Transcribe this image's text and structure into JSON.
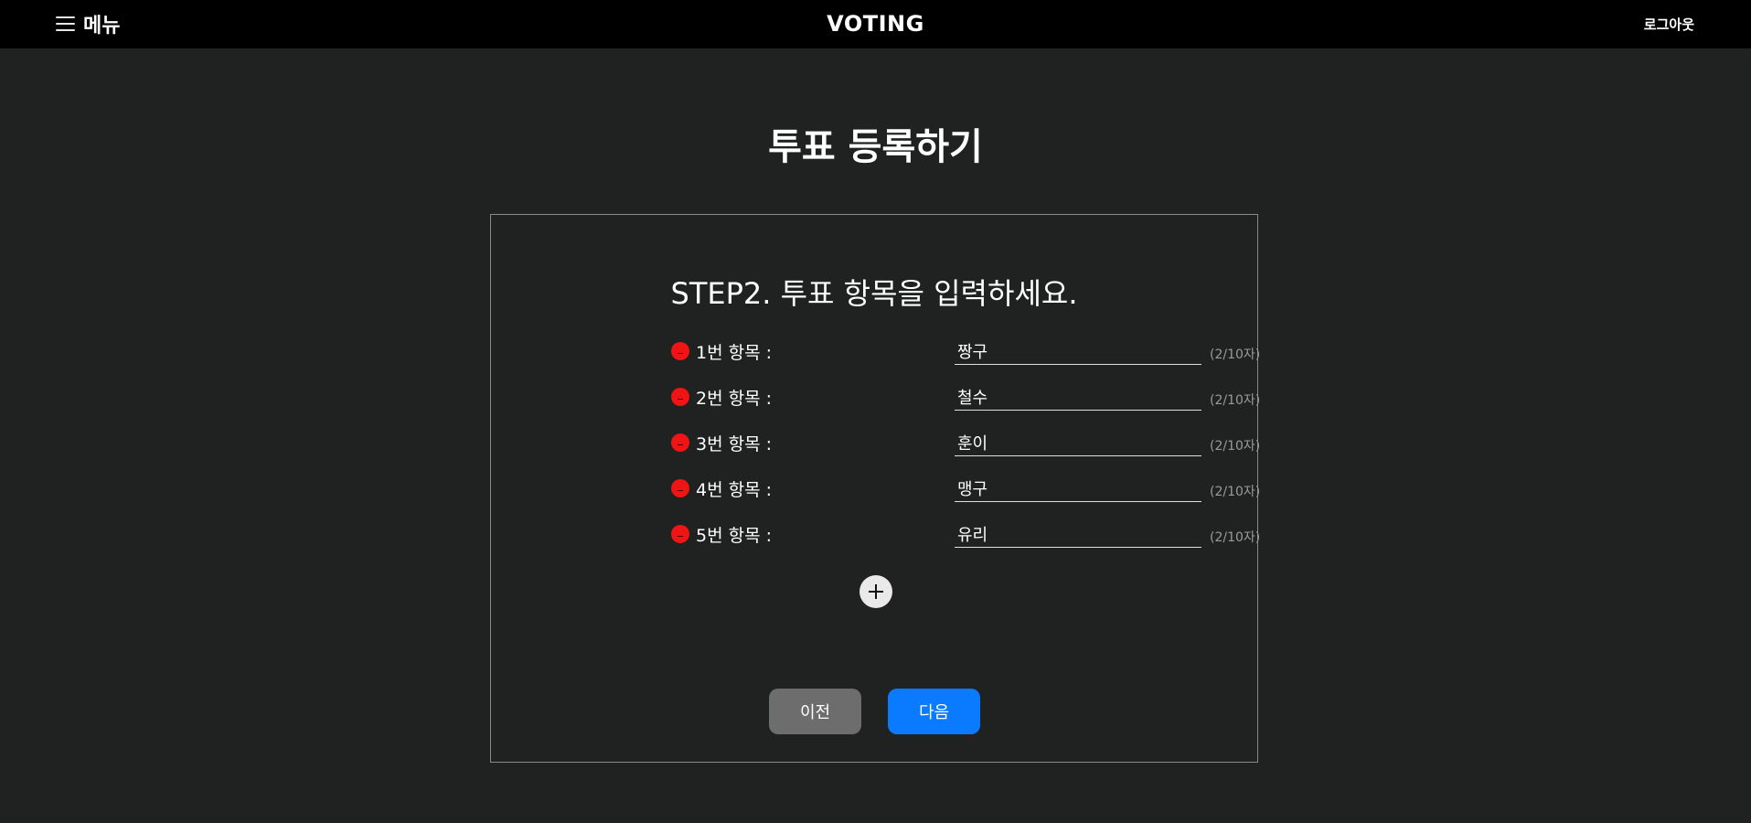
{
  "header": {
    "menu_label": "메뉴",
    "app_title": "VOTING",
    "logout_label": "로그아웃"
  },
  "page_title": "투표 등록하기",
  "step": {
    "title": "STEP2. 투표 항목을 입력하세요.",
    "items": [
      {
        "label": "1번 항목 :",
        "value": "짱구",
        "count": "(2/10자)"
      },
      {
        "label": "2번 항목 :",
        "value": "철수",
        "count": "(2/10자)"
      },
      {
        "label": "3번 항목 :",
        "value": "훈이",
        "count": "(2/10자)"
      },
      {
        "label": "4번 항목 :",
        "value": "맹구",
        "count": "(2/10자)"
      },
      {
        "label": "5번 항목 :",
        "value": "유리",
        "count": "(2/10자)"
      }
    ]
  },
  "buttons": {
    "prev_label": "이전",
    "next_label": "다음"
  },
  "colors": {
    "background": "#202121",
    "topbar": "#000000",
    "remove": "#f01414",
    "next_button": "#0a7bff",
    "prev_button": "#6d6d6d"
  }
}
